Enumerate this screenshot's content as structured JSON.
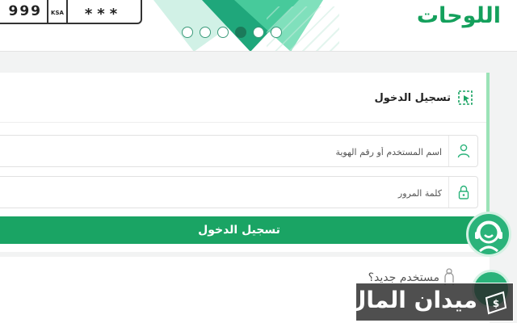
{
  "header": {
    "plate": {
      "number": "999",
      "country": "KSA",
      "letters": "***"
    },
    "slider_dots": [
      {
        "active": false
      },
      {
        "active": false
      },
      {
        "active": false
      },
      {
        "active": true
      },
      {
        "active": false
      },
      {
        "active": false
      }
    ],
    "logo": "اللوحات"
  },
  "login": {
    "title": "تسجيل الدخول",
    "username_placeholder": "اسم المستخدم أو رقم الهوية",
    "password_placeholder": "كلمة المرور",
    "submit_label": "تسجيل الدخول"
  },
  "register": {
    "label": "مستخدم جديد؟"
  },
  "watermark": {
    "text": "ميدان المال"
  },
  "colors": {
    "brand_green": "#1aa464",
    "logo_green": "#14a05c",
    "accent_border": "#9be3b7",
    "banner_teal": "#1fa77b"
  },
  "icons": {
    "login": "login-cursor-icon",
    "user": "user-icon",
    "lock": "lock-icon",
    "chat": "support-agent-icon",
    "new_user": "person-icon",
    "watermark": "money-icon"
  }
}
